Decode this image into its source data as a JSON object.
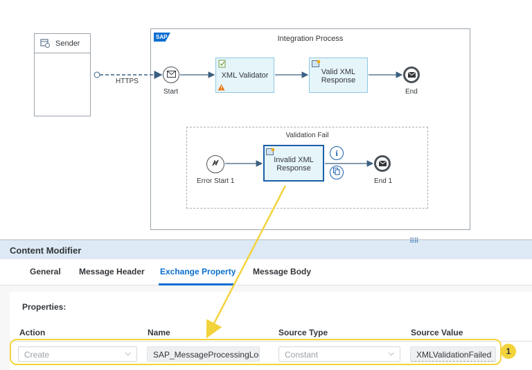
{
  "canvas": {
    "sender": {
      "label": "Sender"
    },
    "integration_process": {
      "title": "Integration Process",
      "logo_text": "SAP"
    },
    "connection": {
      "label": "HTTPS"
    },
    "start_event": {
      "label": "Start"
    },
    "xml_validator": {
      "line1": "XML Validator"
    },
    "valid_xml_response": {
      "line1": "Valid XML",
      "line2": "Response"
    },
    "end_event": {
      "label": "End"
    },
    "validation_fail": {
      "title": "Validation Fail",
      "error_start": {
        "label": "Error Start 1"
      },
      "invalid_xml_response": {
        "line1": "Invalid XML",
        "line2": "Response"
      },
      "end1": {
        "label": "End 1"
      }
    }
  },
  "panel": {
    "title": "Content Modifier",
    "tabs": [
      {
        "label": "General"
      },
      {
        "label": "Message Header"
      },
      {
        "label": "Exchange Property"
      },
      {
        "label": "Message Body"
      }
    ],
    "active_tab": "Exchange Property",
    "properties_label": "Properties:",
    "columns": [
      "Action",
      "Name",
      "Source Type",
      "Source Value"
    ],
    "row": {
      "action": "Create",
      "name": "SAP_MessageProcessingLog",
      "source_type": "Constant",
      "source_value": "XMLValidationFailed"
    },
    "callout": "1"
  },
  "colors": {
    "accent": "#0a6ed1",
    "selected_border": "#1a5fa8",
    "task_fill": "#e6f5fa",
    "highlight": "#f3d33c",
    "warning": "#e9730c"
  }
}
